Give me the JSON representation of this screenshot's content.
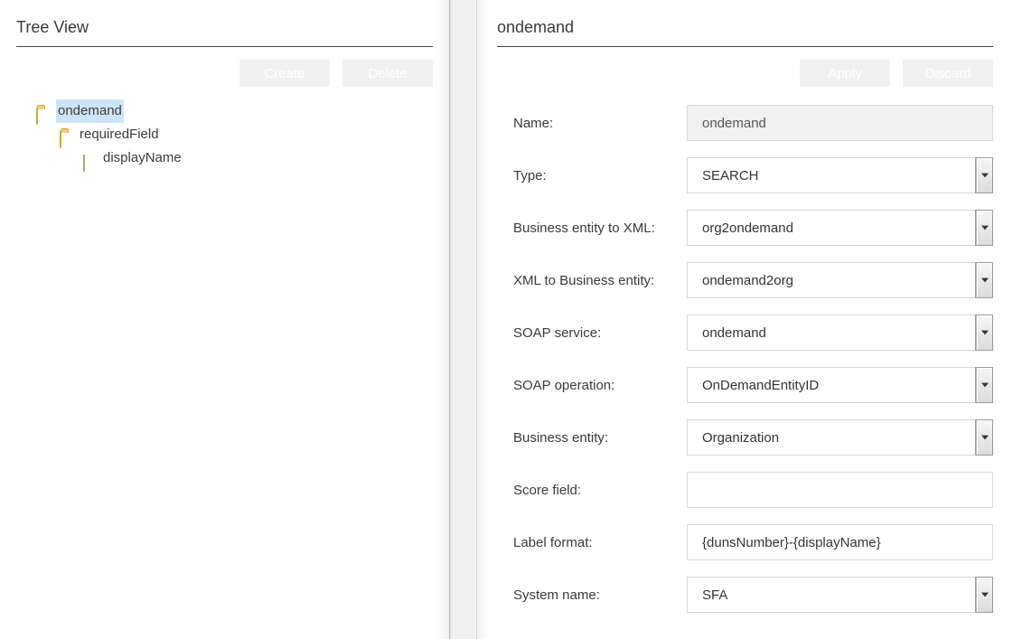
{
  "left": {
    "title": "Tree View",
    "buttons": {
      "create": "Create",
      "delete": "Delete"
    },
    "tree": {
      "root": "ondemand",
      "child1": "requiredField",
      "child2": "displayName"
    }
  },
  "right": {
    "title": "ondemand",
    "buttons": {
      "apply": "Apply",
      "discard": "Discard"
    },
    "fields": {
      "name": {
        "label": "Name:",
        "value": "ondemand"
      },
      "type": {
        "label": "Type:",
        "value": "SEARCH"
      },
      "be2xml": {
        "label": "Business entity to XML:",
        "value": "org2ondemand"
      },
      "xml2be": {
        "label": "XML to Business entity:",
        "value": "ondemand2org"
      },
      "soapService": {
        "label": "SOAP service:",
        "value": "ondemand"
      },
      "soapOperation": {
        "label": "SOAP operation:",
        "value": "OnDemandEntityID"
      },
      "businessEntity": {
        "label": "Business entity:",
        "value": "Organization"
      },
      "scoreField": {
        "label": "Score field:",
        "value": ""
      },
      "labelFormat": {
        "label": "Label format:",
        "value": "{dunsNumber}-{displayName}"
      },
      "systemName": {
        "label": "System name:",
        "value": "SFA"
      }
    }
  }
}
